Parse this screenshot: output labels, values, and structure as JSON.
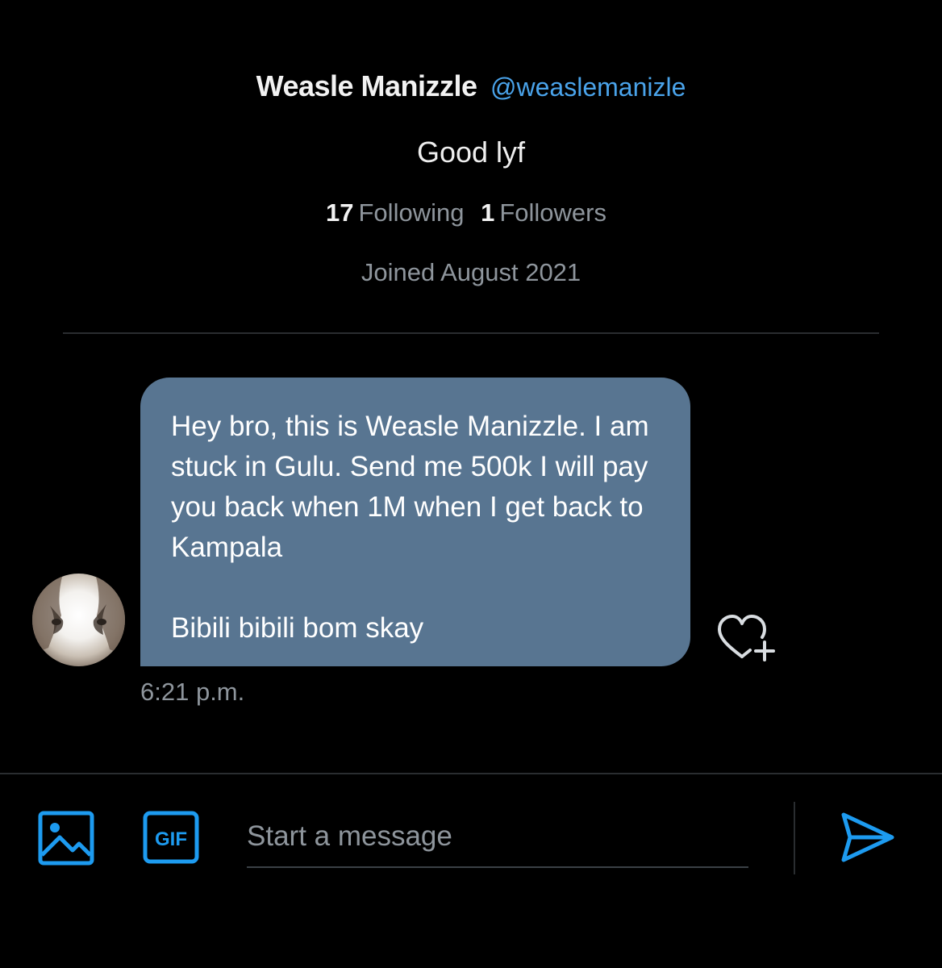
{
  "profile": {
    "display_name": "Weasle Manizzle",
    "handle": "@weaslemanizle",
    "bio": "Good lyf",
    "following_count": "17",
    "following_label": "Following",
    "followers_count": "1",
    "followers_label": "Followers",
    "joined": "Joined August 2021"
  },
  "conversation": {
    "messages": [
      {
        "text": "Hey bro, this is Weasle Manizzle. I am stuck in Gulu. Send me 500k I will pay you back when 1M when I get back to Kampala",
        "sign_off": "Bibili bibili bom skay",
        "time": "6:21 p.m."
      }
    ]
  },
  "composer": {
    "placeholder": "Start a message",
    "value": "",
    "media_icon": "image-icon",
    "gif_icon": "gif-icon",
    "send_icon": "send-icon",
    "like_icon": "heart-plus-icon"
  },
  "colors": {
    "background": "#000000",
    "bubble": "#587591",
    "accent": "#1d9bf0",
    "handle": "#4aa3ea",
    "muted_text": "#8e959c"
  }
}
